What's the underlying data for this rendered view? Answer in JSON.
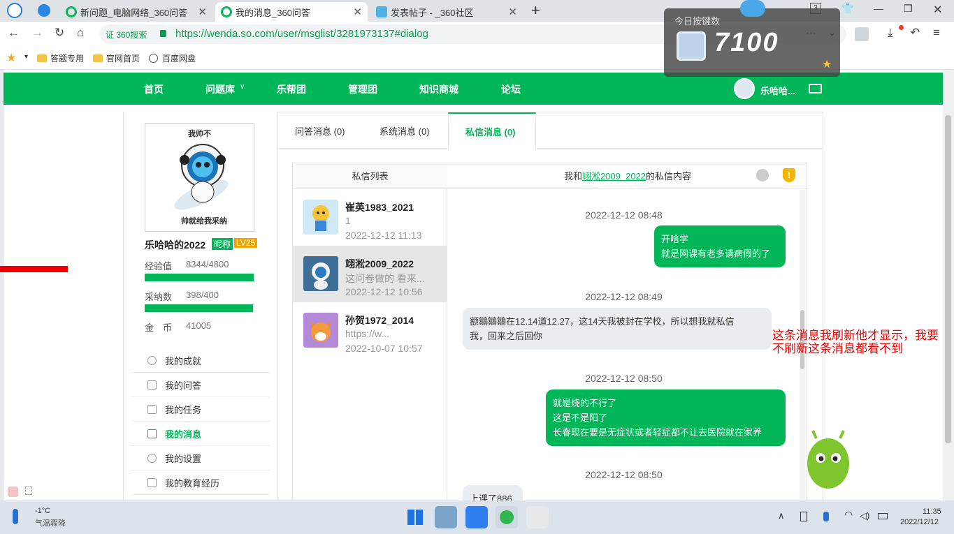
{
  "browser": {
    "tabs": [
      {
        "title": "新问题_电脑网络_360问答"
      },
      {
        "title": "我的消息_360问答"
      },
      {
        "title": "发表帖子 - _360社区"
      }
    ],
    "tab_count": "3",
    "url_badge": "证 360搜索",
    "url": "https://wenda.so.com/user/msglist/3281973137#dialog",
    "bookmarks": [
      "答题专用",
      "官网首页",
      "百度网盘"
    ]
  },
  "key_overlay": {
    "title": "今日按键数",
    "count": "7100"
  },
  "site_nav": {
    "items": [
      "首页",
      "问题库",
      "乐帮团",
      "管理团",
      "知识商城",
      "论坛"
    ],
    "username": "乐哈哈..."
  },
  "profile": {
    "avatar_top": "我帅不",
    "avatar_bottom": "帅就给我采纳",
    "name": "乐哈哈的2022",
    "badge_nick": "昵称",
    "badge_level": "LV25",
    "exp_label": "经验值",
    "exp_value": "8344/4800",
    "exp_fill": 1.0,
    "adopt_label": "采纳数",
    "adopt_value": "398/400",
    "adopt_fill": 0.995,
    "coin_label": "金　币",
    "coin_value": "41005",
    "menu": [
      "我的成就",
      "我的问答",
      "我的任务",
      "我的消息",
      "我的设置",
      "我的教育经历"
    ]
  },
  "message_tabs": [
    "问答消息 (0)",
    "系统消息 (0)",
    "私信消息 (0)"
  ],
  "pm_list": {
    "header": "私信列表",
    "items": [
      {
        "name": "崔英1983_2021",
        "preview": "1",
        "time": "2022-12-12 11:13"
      },
      {
        "name": "翊淞2009_2022",
        "preview": "这问卷做的 看来...",
        "time": "2022-12-12 10:56"
      },
      {
        "name": "孙贺1972_2014",
        "preview": "https://w...",
        "time": "2022-10-07 10:57"
      }
    ]
  },
  "dialog": {
    "header_prefix": "我和",
    "header_user": "翊淞2009_2022",
    "header_suffix": "的私信内容",
    "messages": [
      {
        "time": "2022-12-12 08:48",
        "side": "me",
        "lines": [
          "开啥学",
          "就是网课有老多请病假的了"
        ]
      },
      {
        "time": "2022-12-12 08:49",
        "side": "them",
        "lines": [
          "额鶵鶵鶵在12.14道12.27，这14天我被封在学校，所以想我就私信",
          "我，回来之后回你"
        ]
      },
      {
        "time": "2022-12-12 08:50",
        "side": "me",
        "lines": [
          "就是烧的不行了",
          "这是不是阳了",
          "长春现在要是无症状或者轻症都不让去医院就在家养"
        ]
      },
      {
        "time": "2022-12-12 08:50",
        "side": "them",
        "lines": [
          "上课了886"
        ]
      }
    ]
  },
  "annotation": "这条消息我刷新他才显示，我要不刷新这条消息都看不到",
  "taskbar": {
    "weather_temp": "-1°C",
    "weather_desc": "气温骤降",
    "time": "11:35",
    "date": "2022/12/12"
  }
}
